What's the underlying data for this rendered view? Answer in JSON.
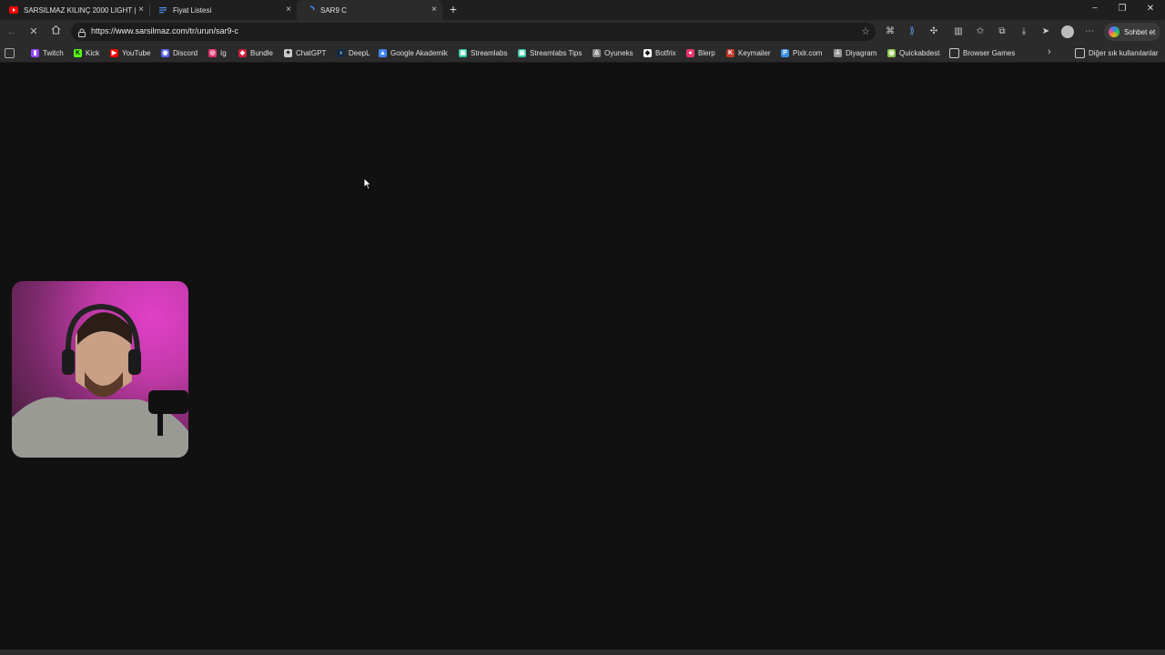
{
  "tabs": [
    {
      "title": "SARSILMAZ KILINÇ 2000 LIGHT |",
      "favicon": "youtube-icon",
      "close": "×"
    },
    {
      "title": "Fiyat Listesi",
      "favicon": "document-icon",
      "close": "×"
    },
    {
      "title": "SAR9 C",
      "favicon": "loading-icon",
      "close": "×"
    }
  ],
  "new_tab_label": "+",
  "window_controls": {
    "minimize": "−",
    "restore": "❐",
    "close": "✕"
  },
  "address_bar": {
    "url": "https://www.sarsilmaz.com/tr/urun/sar9-c"
  },
  "chat_button": {
    "label": "Sohbet et"
  },
  "bookmarks": [
    {
      "label": "Twitch",
      "icon": "twitch-icon",
      "color": "#9146ff"
    },
    {
      "label": "Kick",
      "icon": "kick-icon",
      "color": "#53fc18"
    },
    {
      "label": "YouTube",
      "icon": "youtube-icon",
      "color": "#ff0000"
    },
    {
      "label": "Discord",
      "icon": "discord-icon",
      "color": "#5865f2"
    },
    {
      "label": "Ig",
      "icon": "instagram-icon",
      "color": "#e1306c"
    },
    {
      "label": "Bundle",
      "icon": "bundle-icon",
      "color": "#d11f3a"
    },
    {
      "label": "ChatGPT",
      "icon": "chatgpt-icon",
      "color": "#cccccc"
    },
    {
      "label": "DeepL",
      "icon": "deepl-icon",
      "color": "#0f2b46"
    },
    {
      "label": "Google Akademik",
      "icon": "google-scholar-icon",
      "color": "#4285f4"
    },
    {
      "label": "Streamlabs",
      "icon": "streamlabs-icon",
      "color": "#31c3a2"
    },
    {
      "label": "Streamlabs Tips",
      "icon": "streamlabs-icon",
      "color": "#31c3a2"
    },
    {
      "label": "Oyuneks",
      "icon": "oyuneks-icon",
      "color": "#888888"
    },
    {
      "label": "Botfrix",
      "icon": "botfrix-icon",
      "color": "#ffffff"
    },
    {
      "label": "Blerp",
      "icon": "blerp-icon",
      "color": "#e8336d"
    },
    {
      "label": "Keymailer",
      "icon": "keymailer-icon",
      "color": "#c0392b"
    },
    {
      "label": "Pixlr.com",
      "icon": "pixlr-icon",
      "color": "#3a8dde"
    },
    {
      "label": "Diyagram",
      "icon": "diagram-icon",
      "color": "#999999"
    },
    {
      "label": "Quickabdest",
      "icon": "quickabdest-icon",
      "color": "#8bc34a"
    },
    {
      "label": "Browser Games",
      "icon": "folder-icon",
      "color": "#cccccc"
    }
  ],
  "other_bookmarks": {
    "label": "Diğer sık kullanılanlar",
    "icon": "folder-icon"
  },
  "colors": {
    "page_bg": "#111111",
    "chrome_bg": "#2b2b2b",
    "tabstrip_bg": "#1f1f1f"
  }
}
